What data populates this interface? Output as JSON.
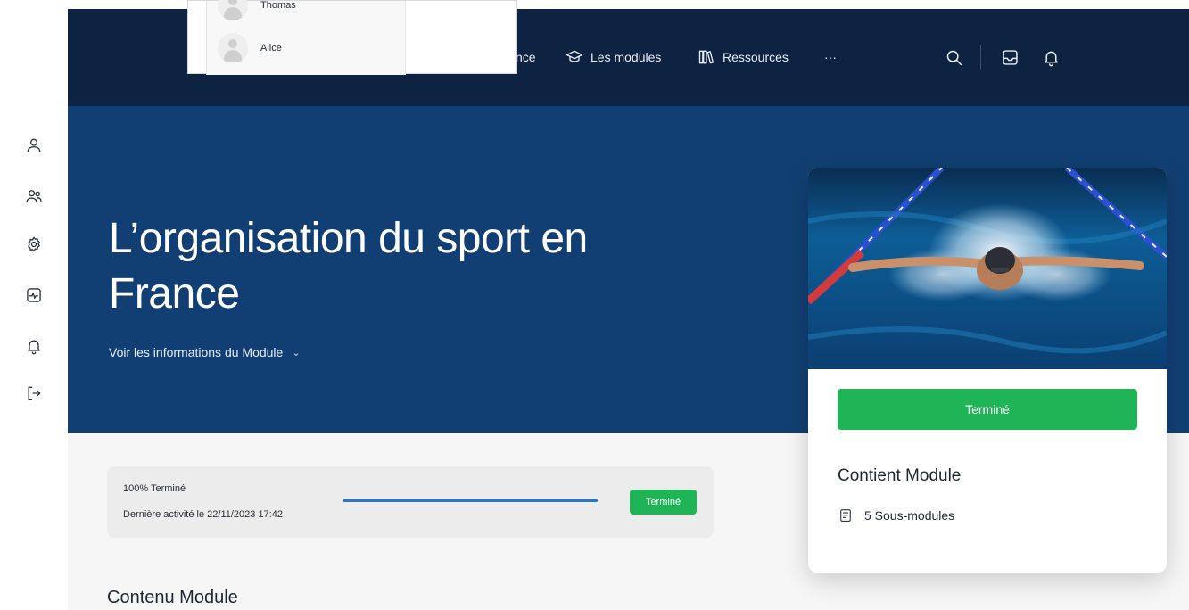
{
  "nav": {
    "items": [
      {
        "label": "nce",
        "icon": "partial-icon"
      },
      {
        "label": "Les modules",
        "icon": "graduation-cap-icon"
      },
      {
        "label": "Ressources",
        "icon": "library-books-icon"
      },
      {
        "label": "···",
        "icon": "more-icon"
      }
    ],
    "right_icons": [
      "search-icon",
      "inbox-icon",
      "bell-icon"
    ]
  },
  "sidebar": {
    "icons": [
      "user-icon",
      "users-icon",
      "settings-gear-icon",
      "activity-icon",
      "bell-icon",
      "logout-icon"
    ]
  },
  "popup": {
    "users": [
      {
        "name": "Thomas"
      },
      {
        "name": "Alice"
      }
    ]
  },
  "hero": {
    "title": "L’organisation du sport en France",
    "info_link": "Voir les informations du Module",
    "info_chevron": "⌄"
  },
  "progress": {
    "percent_label": "100% Terminé",
    "percent": 100,
    "last_activity": "Dernière activité le 22/11/2023 17:42",
    "badge": "Terminé"
  },
  "content": {
    "section_title": "Contenu Module"
  },
  "side_card": {
    "button_label": "Terminé",
    "contient_title": "Contient Module",
    "sous_modules": "5 Sous-modules"
  },
  "colors": {
    "nav_bg": "#0d2341",
    "hero_bg": "#123f73",
    "success": "#1fb455",
    "progress_fill": "#2a78c5"
  }
}
